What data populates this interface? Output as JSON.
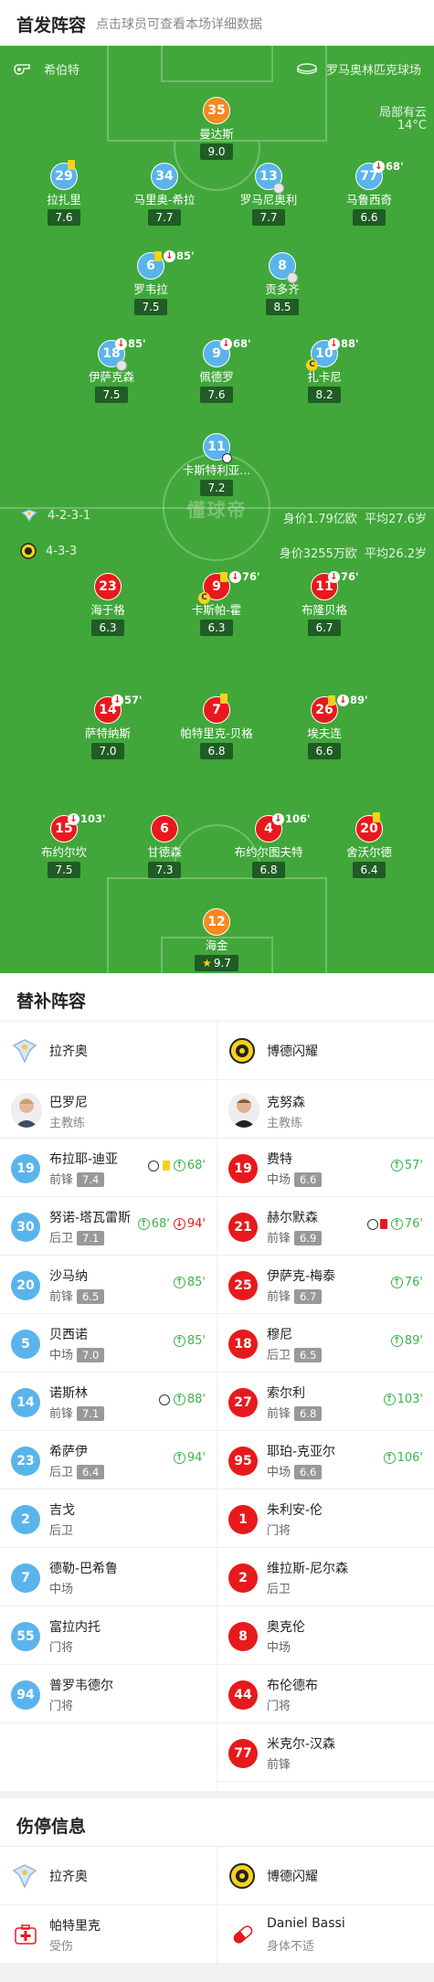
{
  "header": {
    "title": "首发阵容",
    "subtitle": "点击球员可查看本场详细数据"
  },
  "pitch": {
    "referee": "希伯特",
    "stadium": "罗马奥林匹克球场",
    "weather": "局部有云",
    "temperature": "14°C",
    "watermark": "懂球帝",
    "home_team": {
      "formation": "4-2-3-1",
      "value": "身价1.79亿欧",
      "avg_age": "平均27.6岁"
    },
    "away_team": {
      "formation": "4-3-3",
      "value": "身价3255万欧",
      "avg_age": "平均26.2岁"
    }
  },
  "home_players": [
    {
      "num": "35",
      "name": "曼达斯",
      "rating": "9.0",
      "color": "orange"
    },
    {
      "num": "29",
      "name": "拉扎里",
      "rating": "7.6",
      "yellow": true
    },
    {
      "num": "34",
      "name": "马里奥-希拉",
      "rating": "7.7"
    },
    {
      "num": "13",
      "name": "罗马尼奥利",
      "rating": "7.7",
      "injured": true
    },
    {
      "num": "77",
      "name": "马鲁西奇",
      "rating": "6.6",
      "sub_min": "68'"
    },
    {
      "num": "6",
      "name": "罗韦拉",
      "rating": "7.5",
      "yellow": true,
      "sub_min": "85'"
    },
    {
      "num": "8",
      "name": "贡多齐",
      "rating": "8.5",
      "injured": true
    },
    {
      "num": "18",
      "name": "伊萨克森",
      "rating": "7.5",
      "sub_min": "85'",
      "injured": true
    },
    {
      "num": "9",
      "name": "佩德罗",
      "rating": "7.6",
      "sub_min": "68'"
    },
    {
      "num": "10",
      "name": "扎卡尼",
      "rating": "8.2",
      "sub_min": "88'",
      "captain": true
    },
    {
      "num": "11",
      "name": "卡斯特利亚...",
      "rating": "7.2",
      "goal": true
    }
  ],
  "away_players": [
    {
      "num": "23",
      "name": "海于格",
      "rating": "6.3"
    },
    {
      "num": "9",
      "name": "卡斯帕-霍",
      "rating": "6.3",
      "yellow": true,
      "sub_min": "76'",
      "captain": true
    },
    {
      "num": "11",
      "name": "布隆贝格",
      "rating": "6.7",
      "sub_min": "76'"
    },
    {
      "num": "14",
      "name": "萨特纳斯",
      "rating": "7.0",
      "sub_min": "57'"
    },
    {
      "num": "7",
      "name": "帕特里克-贝格",
      "rating": "6.8",
      "yellow": true
    },
    {
      "num": "26",
      "name": "埃夫连",
      "rating": "6.6",
      "yellow": true,
      "sub_min": "89'"
    },
    {
      "num": "15",
      "name": "布约尔坎",
      "rating": "7.5",
      "sub_min": "103'"
    },
    {
      "num": "6",
      "name": "甘德森",
      "rating": "7.3"
    },
    {
      "num": "4",
      "name": "布约尔图夫特",
      "rating": "6.8",
      "sub_min": "106'"
    },
    {
      "num": "20",
      "name": "舍沃尔德",
      "rating": "6.4",
      "yellow": true
    },
    {
      "num": "12",
      "name": "海金",
      "rating": "9.7",
      "color": "orange",
      "star": true
    }
  ],
  "subs": {
    "title": "替补阵容",
    "home_team": "拉齐奥",
    "away_team": "博德闪耀",
    "home_coach": {
      "name": "巴罗尼",
      "role": "主教练"
    },
    "away_coach": {
      "name": "克努森",
      "role": "主教练"
    },
    "home": [
      {
        "num": "19",
        "name": "布拉耶-迪亚",
        "pos": "前锋",
        "rating": "7.4",
        "events": "goal,yellow,in",
        "in": "68'"
      },
      {
        "num": "30",
        "name": "努诺-塔瓦雷斯",
        "pos": "后卫",
        "rating": "7.1",
        "events": "in,out",
        "in": "68'",
        "out": "94'"
      },
      {
        "num": "20",
        "name": "沙马纳",
        "pos": "前锋",
        "rating": "6.5",
        "events": "in",
        "in": "85'"
      },
      {
        "num": "5",
        "name": "贝西诺",
        "pos": "中场",
        "rating": "7.0",
        "events": "in",
        "in": "85'"
      },
      {
        "num": "14",
        "name": "诺斯林",
        "pos": "前锋",
        "rating": "7.1",
        "events": "goal,in",
        "in": "88'"
      },
      {
        "num": "23",
        "name": "希萨伊",
        "pos": "后卫",
        "rating": "6.4",
        "events": "in",
        "in": "94'"
      },
      {
        "num": "2",
        "name": "吉戈",
        "pos": "后卫"
      },
      {
        "num": "7",
        "name": "德勒-巴希鲁",
        "pos": "中场"
      },
      {
        "num": "55",
        "name": "富拉内托",
        "pos": "门将"
      },
      {
        "num": "94",
        "name": "普罗韦德尔",
        "pos": "门将"
      }
    ],
    "away": [
      {
        "num": "19",
        "name": "费特",
        "pos": "中场",
        "rating": "6.6",
        "events": "in",
        "in": "57'"
      },
      {
        "num": "21",
        "name": "赫尔默森",
        "pos": "前锋",
        "rating": "6.9",
        "events": "goal,red,in",
        "in": "76'"
      },
      {
        "num": "25",
        "name": "伊萨克-梅泰",
        "pos": "前锋",
        "rating": "6.7",
        "events": "in",
        "in": "76'"
      },
      {
        "num": "18",
        "name": "穆尼",
        "pos": "后卫",
        "rating": "6.5",
        "events": "in",
        "in": "89'"
      },
      {
        "num": "27",
        "name": "索尔利",
        "pos": "前锋",
        "rating": "6.8",
        "events": "in",
        "in": "103'"
      },
      {
        "num": "95",
        "name": "耶珀-克亚尔",
        "pos": "中场",
        "rating": "6.6",
        "events": "in",
        "in": "106'"
      },
      {
        "num": "1",
        "name": "朱利安-伦",
        "pos": "门将"
      },
      {
        "num": "2",
        "name": "维拉斯-尼尔森",
        "pos": "后卫"
      },
      {
        "num": "8",
        "name": "奥克伦",
        "pos": "中场"
      },
      {
        "num": "44",
        "name": "布伦德布",
        "pos": "门将"
      },
      {
        "num": "77",
        "name": "米克尔-汉森",
        "pos": "前锋"
      }
    ]
  },
  "injuries": {
    "title": "伤停信息",
    "home_team": "拉齐奥",
    "away_team": "博德闪耀",
    "home": [
      {
        "name": "帕特里克",
        "type": "受伤"
      }
    ],
    "away": [
      {
        "name": "Daniel Bassi",
        "type": "身体不适"
      }
    ]
  },
  "colors": {
    "pitch": "#41a73a",
    "home": "#5ab4ec",
    "away": "#e8191c",
    "keeper": "#f7891e",
    "sub_in": "#3ab54a"
  }
}
